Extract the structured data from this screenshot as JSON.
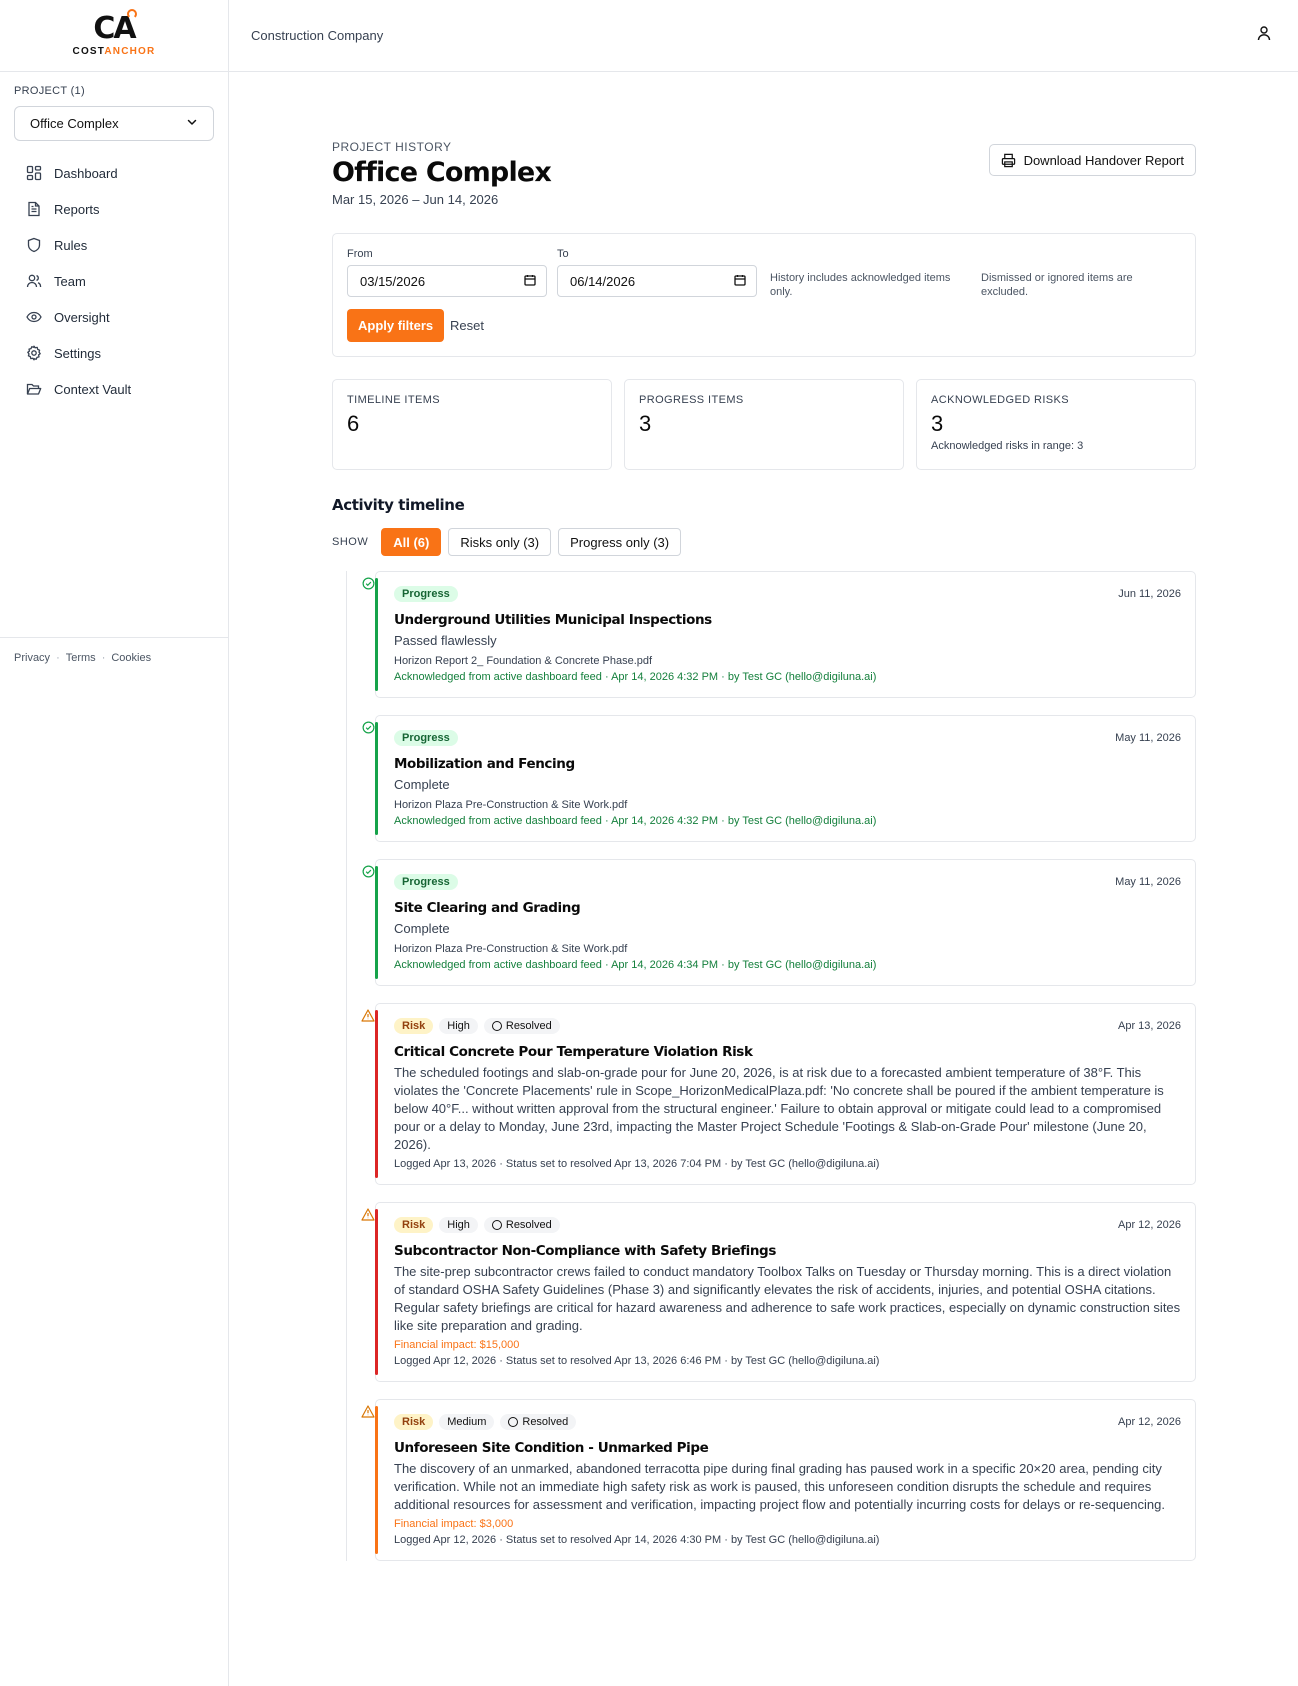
{
  "brand": {
    "mark": "CA",
    "word_a": "COST",
    "word_b": "ANCHOR",
    "accent": "#f97316"
  },
  "sidebar": {
    "project_label": "PROJECT (1)",
    "project_selected": "Office Complex",
    "items": [
      {
        "label": "Dashboard",
        "icon": "dashboard-icon"
      },
      {
        "label": "Reports",
        "icon": "file-text-icon"
      },
      {
        "label": "Rules",
        "icon": "shield-icon"
      },
      {
        "label": "Team",
        "icon": "users-icon"
      },
      {
        "label": "Oversight",
        "icon": "eye-icon"
      },
      {
        "label": "Settings",
        "icon": "gear-icon"
      },
      {
        "label": "Context Vault",
        "icon": "folder-open-icon"
      }
    ],
    "footer": {
      "privacy": "Privacy",
      "terms": "Terms",
      "cookies": "Cookies",
      "sep": "·"
    }
  },
  "header": {
    "company": "Construction Company"
  },
  "page": {
    "kicker": "PROJECT HISTORY",
    "title": "Office Complex",
    "date_range": "Mar 15, 2026 – Jun 14, 2026",
    "download_label": "Download Handover Report"
  },
  "filters": {
    "from_label": "From",
    "from_value": "03/15/2026",
    "to_label": "To",
    "to_value": "06/14/2026",
    "note_1": "History includes acknowledged items only.",
    "note_2": "Dismissed or ignored items are excluded.",
    "apply_label": "Apply filters",
    "reset_label": "Reset"
  },
  "stats": {
    "timeline": {
      "label": "TIMELINE ITEMS",
      "value": "6"
    },
    "progress": {
      "label": "PROGRESS ITEMS",
      "value": "3"
    },
    "risks": {
      "label": "ACKNOWLEDGED RISKS",
      "value": "3",
      "sub": "Acknowledged risks in range: 3"
    }
  },
  "timeline": {
    "title": "Activity timeline",
    "show_label": "SHOW",
    "filters": [
      "All (6)",
      "Risks only (3)",
      "Progress only (3)"
    ],
    "items": [
      {
        "type": "Progress",
        "date": "Jun 11, 2026",
        "title": "Underground Utilities Municipal Inspections",
        "desc": "Passed flawlessly",
        "file": "Horizon Report 2_ Foundation & Concrete Phase.pdf",
        "meta": "Acknowledged from active dashboard feed · Apr 14, 2026 4:32 PM · by Test GC (hello@digiluna.ai)"
      },
      {
        "type": "Progress",
        "date": "May 11, 2026",
        "title": "Mobilization and Fencing",
        "desc": "Complete",
        "file": "Horizon Plaza Pre-Construction & Site Work.pdf",
        "meta": "Acknowledged from active dashboard feed · Apr 14, 2026 4:32 PM · by Test GC (hello@digiluna.ai)"
      },
      {
        "type": "Progress",
        "date": "May 11, 2026",
        "title": "Site Clearing and Grading",
        "desc": "Complete",
        "file": "Horizon Plaza Pre-Construction & Site Work.pdf",
        "meta": "Acknowledged from active dashboard feed · Apr 14, 2026 4:34 PM · by Test GC (hello@digiluna.ai)"
      },
      {
        "type": "Risk",
        "severity": "High",
        "status": "Resolved",
        "date": "Apr 13, 2026",
        "title": "Critical Concrete Pour Temperature Violation Risk",
        "desc": "The scheduled footings and slab-on-grade pour for June 20, 2026, is at risk due to a forecasted ambient temperature of 38°F. This violates the 'Concrete Placements' rule in Scope_HorizonMedicalPlaza.pdf: 'No concrete shall be poured if the ambient temperature is below 40°F... without written approval from the structural engineer.' Failure to obtain approval or mitigate could lead to a compromised pour or a delay to Monday, June 23rd, impacting the Master Project Schedule 'Footings & Slab-on-Grade Pour' milestone (June 20, 2026).",
        "meta": "Logged Apr 13, 2026 · Status set to resolved Apr 13, 2026 7:04 PM · by Test GC (hello@digiluna.ai)"
      },
      {
        "type": "Risk",
        "severity": "High",
        "status": "Resolved",
        "date": "Apr 12, 2026",
        "title": "Subcontractor Non-Compliance with Safety Briefings",
        "desc": "The site-prep subcontractor crews failed to conduct mandatory Toolbox Talks on Tuesday or Thursday morning. This is a direct violation of standard OSHA Safety Guidelines (Phase 3) and significantly elevates the risk of accidents, injuries, and potential OSHA citations. Regular safety briefings are critical for hazard awareness and adherence to safe work practices, especially on dynamic construction sites like site preparation and grading.",
        "impact": "Financial impact: $15,000",
        "meta": "Logged Apr 12, 2026 · Status set to resolved Apr 13, 2026 6:46 PM · by Test GC (hello@digiluna.ai)"
      },
      {
        "type": "Risk",
        "severity": "Medium",
        "status": "Resolved",
        "date": "Apr 12, 2026",
        "title": "Unforeseen Site Condition - Unmarked Pipe",
        "desc": "The discovery of an unmarked, abandoned terracotta pipe during final grading has paused work in a specific 20×20 area, pending city verification. While not an immediate high safety risk as work is paused, this unforeseen condition disrupts the schedule and requires additional resources for assessment and verification, impacting project flow and potentially incurring costs for delays or re-sequencing.",
        "impact": "Financial impact: $3,000",
        "meta": "Logged Apr 12, 2026 · Status set to resolved Apr 14, 2026 4:30 PM · by Test GC (hello@digiluna.ai)"
      }
    ]
  },
  "colors": {
    "progress_accent": "#16a34a",
    "risk_high_accent": "#dc2626",
    "risk_medium_accent": "#f97316",
    "warn_icon": "#d97706"
  }
}
